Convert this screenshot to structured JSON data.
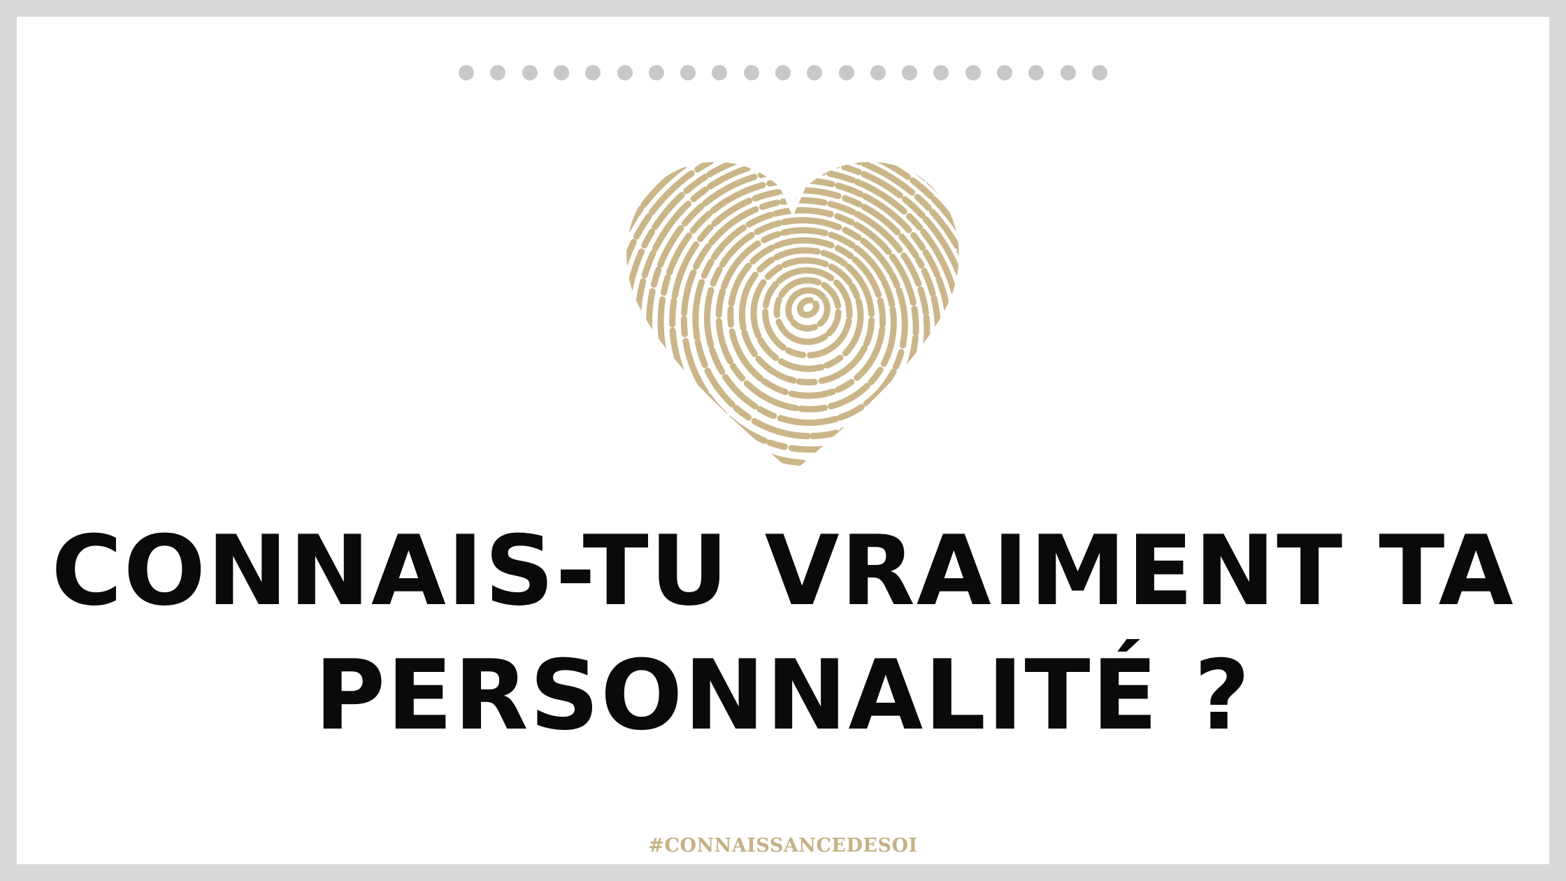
{
  "slide": {
    "title_line1": "CONNAIS-TU VRAIMENT TA",
    "title_line2": "PERSONNALITÉ ?",
    "hashtag": "#CONNAISSANCEDESOI",
    "dot_count": 21,
    "illustration": "fingerprint-heart-icon"
  },
  "colors": {
    "outer_border": "#d9d9d9",
    "background": "#ffffff",
    "dots": "#c8c8c8",
    "fingerprint": "#cbb68a",
    "title": "#0a0a0a",
    "hashtag": "#c5b185"
  }
}
